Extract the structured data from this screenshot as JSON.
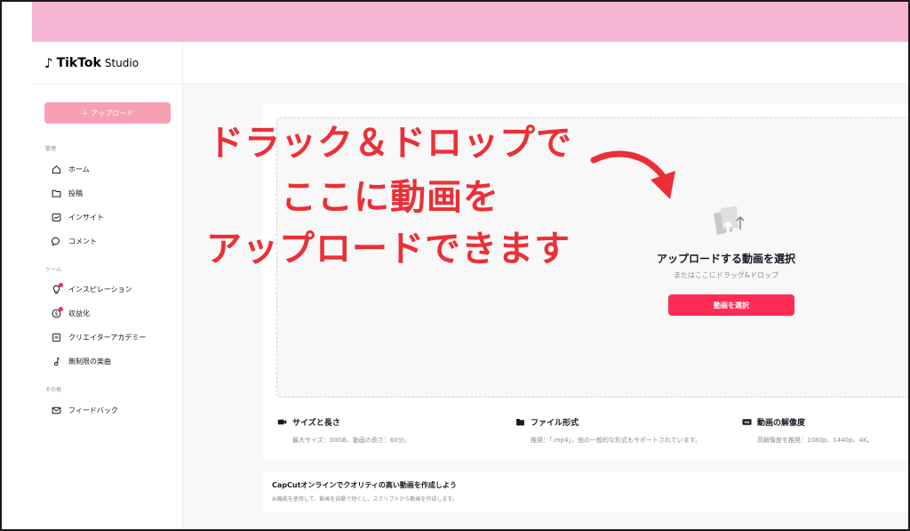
{
  "app": {
    "logo_brand": "TikTok",
    "logo_product": "Studio"
  },
  "colors": {
    "accent": "#fe2c55",
    "upload_button": "#f8a0b3",
    "top_bar": "#f5b5d2",
    "overlay_text": "#ec2f36"
  },
  "sidebar": {
    "upload_button": "＋ アップロード",
    "sections": {
      "manage": "管理",
      "tools": "ツール",
      "other": "その他"
    },
    "items": [
      {
        "label": "ホーム",
        "icon": "home-icon"
      },
      {
        "label": "投稿",
        "icon": "folder-icon"
      },
      {
        "label": "インサイト",
        "icon": "chart-icon"
      },
      {
        "label": "コメント",
        "icon": "comment-icon"
      },
      {
        "label": "インスピレーション",
        "icon": "lightbulb-icon"
      },
      {
        "label": "収益化",
        "icon": "dollar-icon"
      },
      {
        "label": "クリエイターアカデミー",
        "icon": "book-icon"
      },
      {
        "label": "無制限の楽曲",
        "icon": "music-note-icon"
      },
      {
        "label": "フィードバック",
        "icon": "mail-icon"
      }
    ]
  },
  "upload": {
    "title": "アップロードする動画を選択",
    "subtitle": "またはここにドラッグ&ドロップ",
    "button": "動画を選択"
  },
  "info": [
    {
      "title": "サイズと長さ",
      "desc": "最大サイズ：30GB、動画の長さ：60分。",
      "icon": "video-camera-icon"
    },
    {
      "title": "ファイル形式",
      "desc": "推奨：「.mp4」。他の一般的な形式もサポートされています。",
      "icon": "file-icon"
    },
    {
      "title": "動画の解像度",
      "desc": "高解像度を推奨：1080p、1440p、4K。",
      "icon": "hd-icon"
    }
  ],
  "capcut": {
    "title": "CapCutオンラインでクオリティの高い動画を作成しよう",
    "desc": "AI機能を使用して、動画を自動で短くし、スクリプトから動画を作成します。"
  },
  "annotation": {
    "line1": "ドラック＆ドロップで",
    "line2": "ここに動画を",
    "line3": "アップロードできます"
  }
}
